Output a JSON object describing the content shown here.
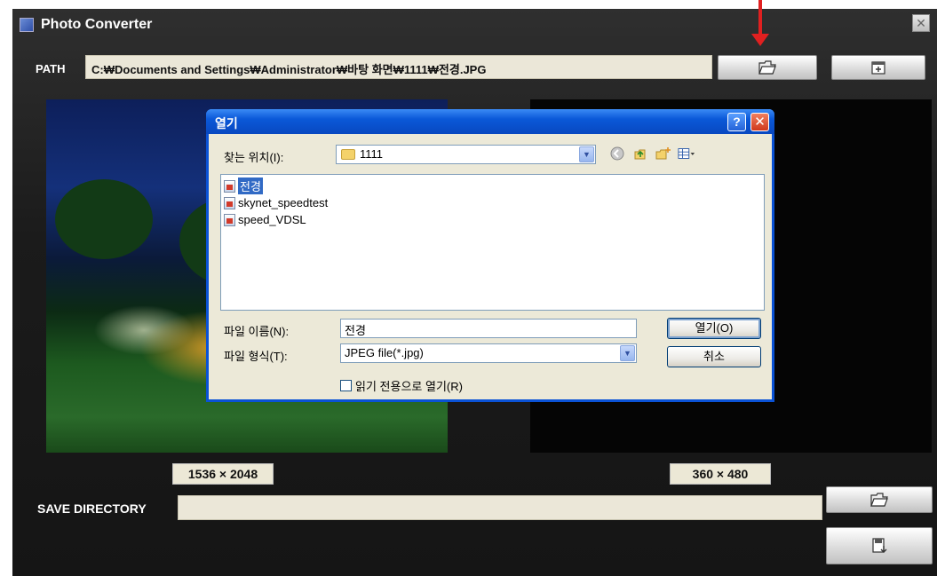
{
  "window": {
    "title": "Photo Converter",
    "close_glyph": "✕"
  },
  "path": {
    "label": "PATH",
    "value": "C:₩Documents and Settings₩Administrator₩바탕 화면₩1111₩전경.JPG"
  },
  "sizes": {
    "source": "1536 × 2048",
    "target": "360 × 480"
  },
  "save": {
    "label": "SAVE DIRECTORY",
    "value": ""
  },
  "dialog": {
    "title": "열기",
    "help_label": "?",
    "close_label": "✕",
    "look_in_label": "찾는 위치(I):",
    "look_in_value": "1111",
    "files": [
      {
        "name": "전경",
        "selected": true
      },
      {
        "name": "skynet_speedtest",
        "selected": false
      },
      {
        "name": "speed_VDSL",
        "selected": false
      }
    ],
    "filename_label": "파일 이름(N):",
    "filename_value": "전경",
    "filetype_label": "파일 형식(T):",
    "filetype_value": "JPEG file(*.jpg)",
    "open_button": "열기(O)",
    "cancel_button": "취소",
    "readonly_label": "읽기 전용으로 열기(R)"
  },
  "icons": [
    "folder-open-icon",
    "export-icon",
    "save-icon",
    "back-icon",
    "up-folder-icon",
    "new-folder-icon",
    "view-menu-icon"
  ],
  "colors": {
    "arrow": "#e02020",
    "dialog_title": "#0a58d8",
    "selection": "#316ac5"
  }
}
